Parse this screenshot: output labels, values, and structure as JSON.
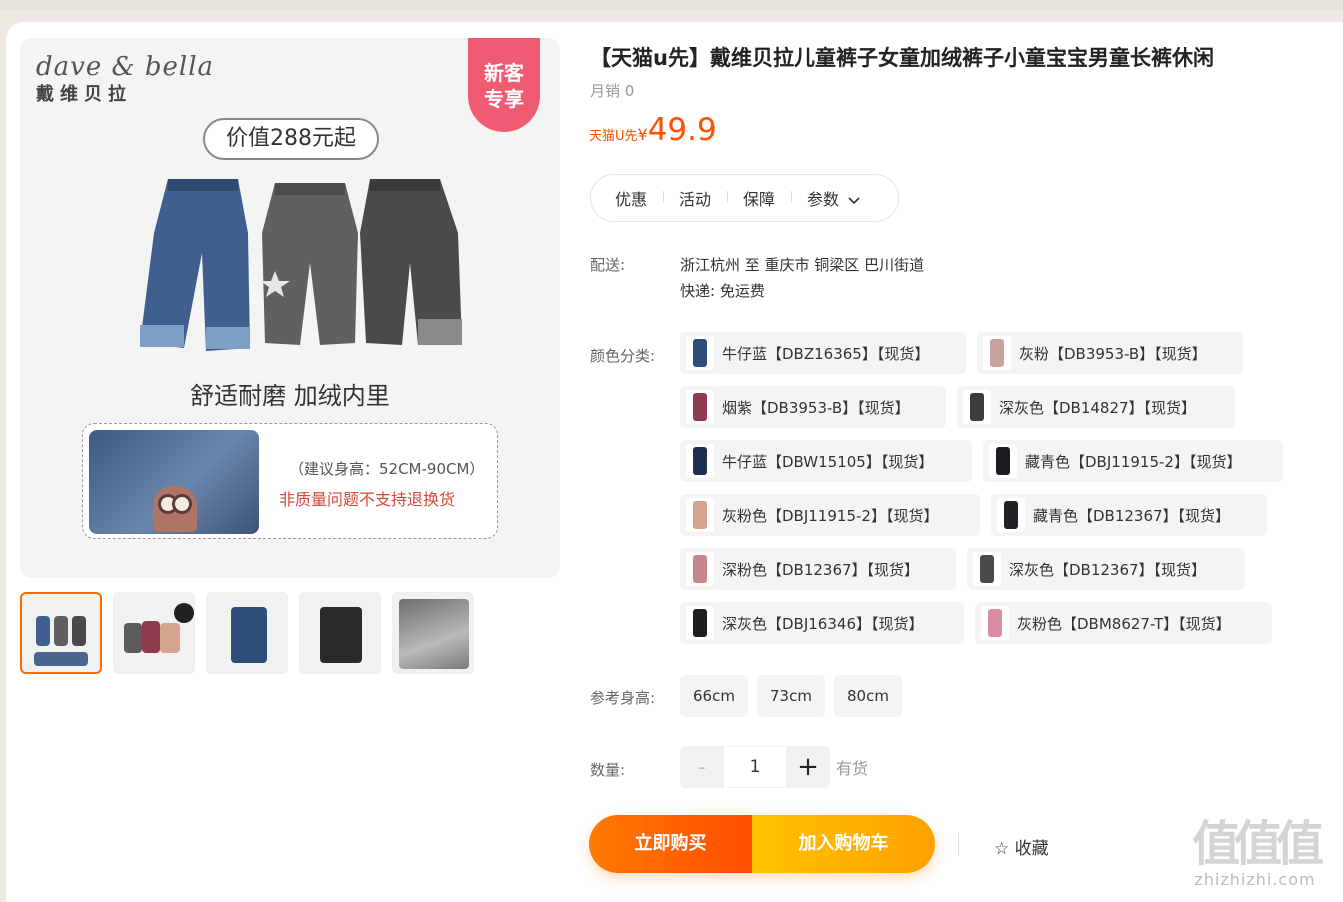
{
  "product": {
    "title": "【天猫u先】戴维贝拉儿童裤子女童加绒裤子小童宝宝男童长裤休闲",
    "sales": "月销 0",
    "price_tag": "天猫U先",
    "currency": "¥",
    "price": "49.9"
  },
  "image": {
    "brand_en": "dave & bella",
    "brand_cn": "戴维贝拉",
    "ribbon": "新客专享",
    "ribbon_line1": "新客",
    "ribbon_line2": "专享",
    "value": "价值288元起",
    "comfort": "舒适耐磨 加绒内里",
    "height_hint": "（建议身高：52CM-90CM）",
    "notice": "非质量问题不支持退换货"
  },
  "tabs": [
    "优惠",
    "活动",
    "保障",
    "参数"
  ],
  "shipping": {
    "label": "配送:",
    "route": "浙江杭州 至 重庆市 铜梁区 巴川街道",
    "express": "快递: 免运费"
  },
  "color_label": "颜色分类:",
  "colors": [
    {
      "label": "牛仔蓝【DBZ16365】【现货】",
      "color": "#2f4f7a"
    },
    {
      "label": "灰粉【DB3953-B】【现货】",
      "color": "#c9a39a"
    },
    {
      "label": "烟紫【DB3953-B】【现货】",
      "color": "#8e3a4f"
    },
    {
      "label": "深灰色【DB14827】【现货】",
      "color": "#3c3c3c"
    },
    {
      "label": "牛仔蓝【DBW15105】【现货】",
      "color": "#1f2f4d"
    },
    {
      "label": "藏青色【DBJ11915-2】【现货】",
      "color": "#1c1c22"
    },
    {
      "label": "灰粉色【DBJ11915-2】【现货】",
      "color": "#d4a48c"
    },
    {
      "label": "藏青色【DB12367】【现货】",
      "color": "#222226"
    },
    {
      "label": "深粉色【DB12367】【现货】",
      "color": "#c7858c"
    },
    {
      "label": "深灰色【DB12367】【现货】",
      "color": "#4a4a4a"
    },
    {
      "label": "深灰色【DBJ16346】【现货】",
      "color": "#1e1e1e"
    },
    {
      "label": "灰粉色【DBM8627-T】【现货】",
      "color": "#d98ea2"
    }
  ],
  "size_label": "参考身高:",
  "sizes": [
    "66cm",
    "73cm",
    "80cm"
  ],
  "quantity": {
    "label": "数量:",
    "minus": "-",
    "value": "1",
    "plus": "+",
    "stock": "有货"
  },
  "actions": {
    "buy_now": "立即购买",
    "add_cart": "加入购物车",
    "favorite": "☆ 收藏"
  },
  "watermark": {
    "big": "值值值",
    "small": "zhizhizhi.com"
  }
}
